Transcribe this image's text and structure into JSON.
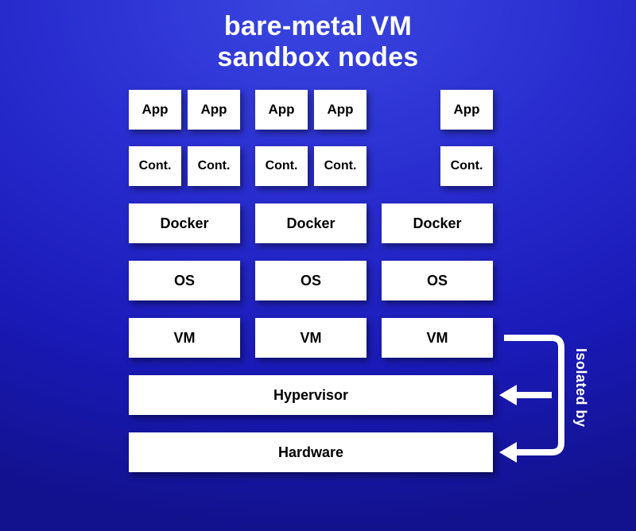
{
  "title_line1": "bare-metal VM",
  "title_line2": "sandbox nodes",
  "layers": {
    "app": "App",
    "cont": "Cont.",
    "docker": "Docker",
    "os": "OS",
    "vm": "VM",
    "hypervisor": "Hypervisor",
    "hardware": "Hardware"
  },
  "annotation": {
    "isolated_by": "Isolated by"
  }
}
